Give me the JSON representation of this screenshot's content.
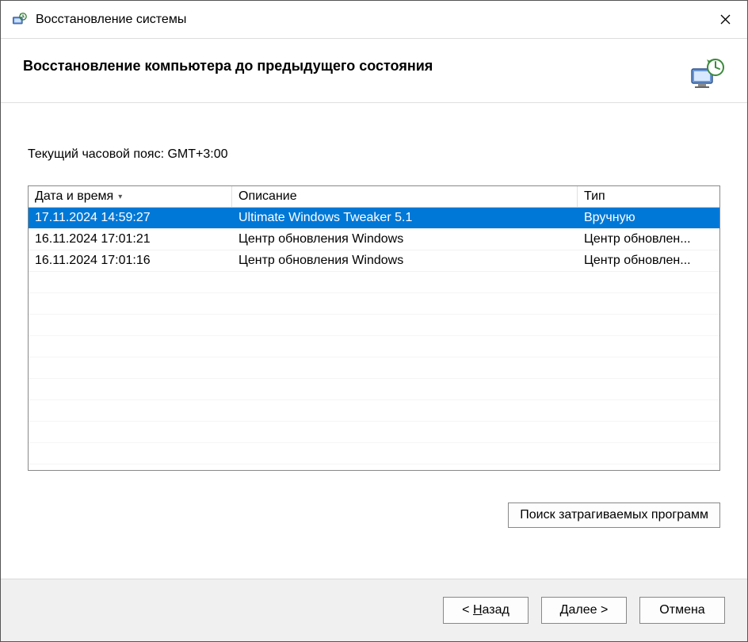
{
  "titlebar": {
    "title": "Восстановление системы"
  },
  "header": {
    "heading": "Восстановление компьютера до предыдущего состояния"
  },
  "timezone_label": "Текущий часовой пояс: GMT+3:00",
  "table": {
    "columns": {
      "datetime": "Дата и время",
      "description": "Описание",
      "type": "Тип"
    },
    "rows": [
      {
        "datetime": "17.11.2024 14:59:27",
        "description": "Ultimate Windows Tweaker 5.1",
        "type": "Вручную",
        "selected": true
      },
      {
        "datetime": "16.11.2024 17:01:21",
        "description": "Центр обновления Windows",
        "type": "Центр обновлен...",
        "selected": false
      },
      {
        "datetime": "16.11.2024 17:01:16",
        "description": "Центр обновления Windows",
        "type": "Центр обновлен...",
        "selected": false
      }
    ]
  },
  "buttons": {
    "scan": "Поиск затрагиваемых программ",
    "back_prefix": "< ",
    "back_u": "Н",
    "back_suffix": "азад",
    "next_u": "Д",
    "next_suffix": "алее >",
    "cancel": "Отмена"
  }
}
